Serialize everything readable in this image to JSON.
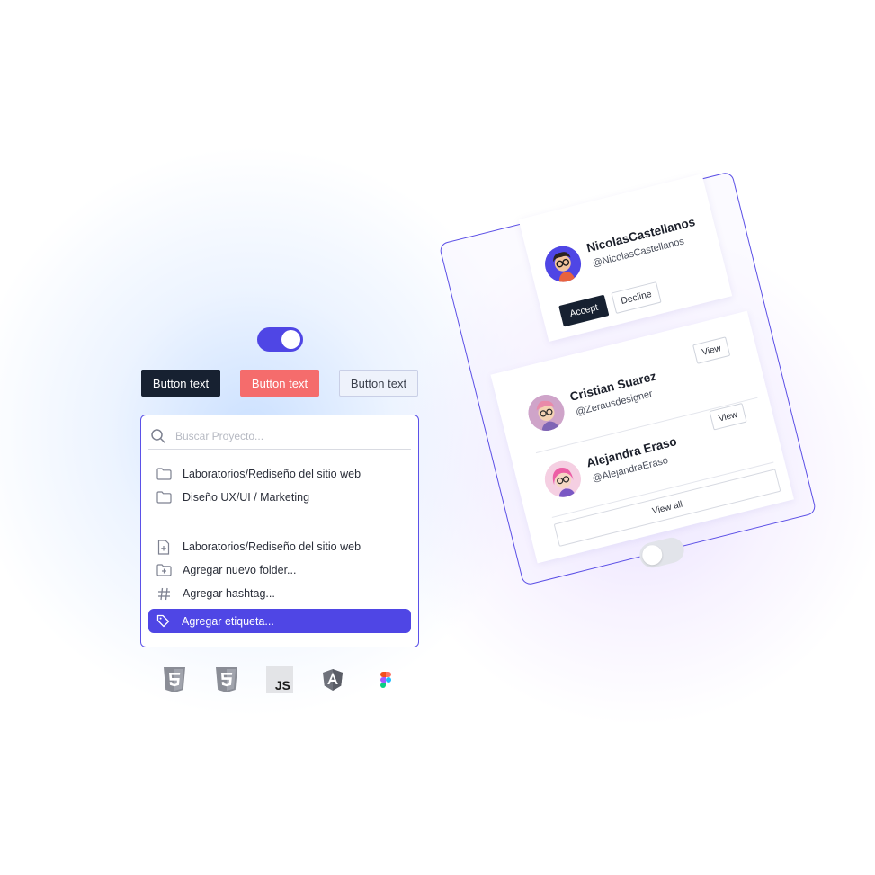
{
  "toggle": {
    "state": "on",
    "accent": "#4f46e5"
  },
  "buttons": [
    {
      "label": "Button text",
      "variant": "dark"
    },
    {
      "label": "Button text",
      "variant": "danger"
    },
    {
      "label": "Button text",
      "variant": "ghost"
    }
  ],
  "palette": {
    "search_placeholder": "Buscar Proyecto...",
    "recent": [
      {
        "icon": "folder-icon",
        "label": "Laboratorios/Rediseño del sitio web"
      },
      {
        "icon": "folder-icon",
        "label": "Diseño UX/UI / Marketing"
      }
    ],
    "actions": [
      {
        "icon": "file-plus-icon",
        "label": "Laboratorios/Rediseño del sitio web"
      },
      {
        "icon": "folder-plus-icon",
        "label": "Agregar nuevo folder..."
      },
      {
        "icon": "hashtag-icon",
        "label": "Agregar  hashtag..."
      },
      {
        "icon": "tag-icon",
        "label": "Agregar etiqueta...",
        "active": true
      }
    ]
  },
  "tech_icons": [
    {
      "icon": "html5-icon"
    },
    {
      "icon": "css3-icon"
    },
    {
      "icon": "javascript-icon",
      "text": "JS"
    },
    {
      "icon": "angular-icon"
    },
    {
      "icon": "figma-icon"
    }
  ],
  "friend_request": {
    "name": "NicolasCastellanos",
    "handle": "@NicolasCastellanos",
    "accept_label": "Accept",
    "decline_label": "Decline"
  },
  "people": [
    {
      "name": "Cristian Suarez",
      "handle": "@Zerausdesigner",
      "view_label": "View"
    },
    {
      "name": "Alejandra Eraso",
      "handle": "@AlejandraEraso",
      "view_label": "View"
    }
  ],
  "view_all_label": "View all",
  "card_toggle": {
    "state": "off"
  }
}
